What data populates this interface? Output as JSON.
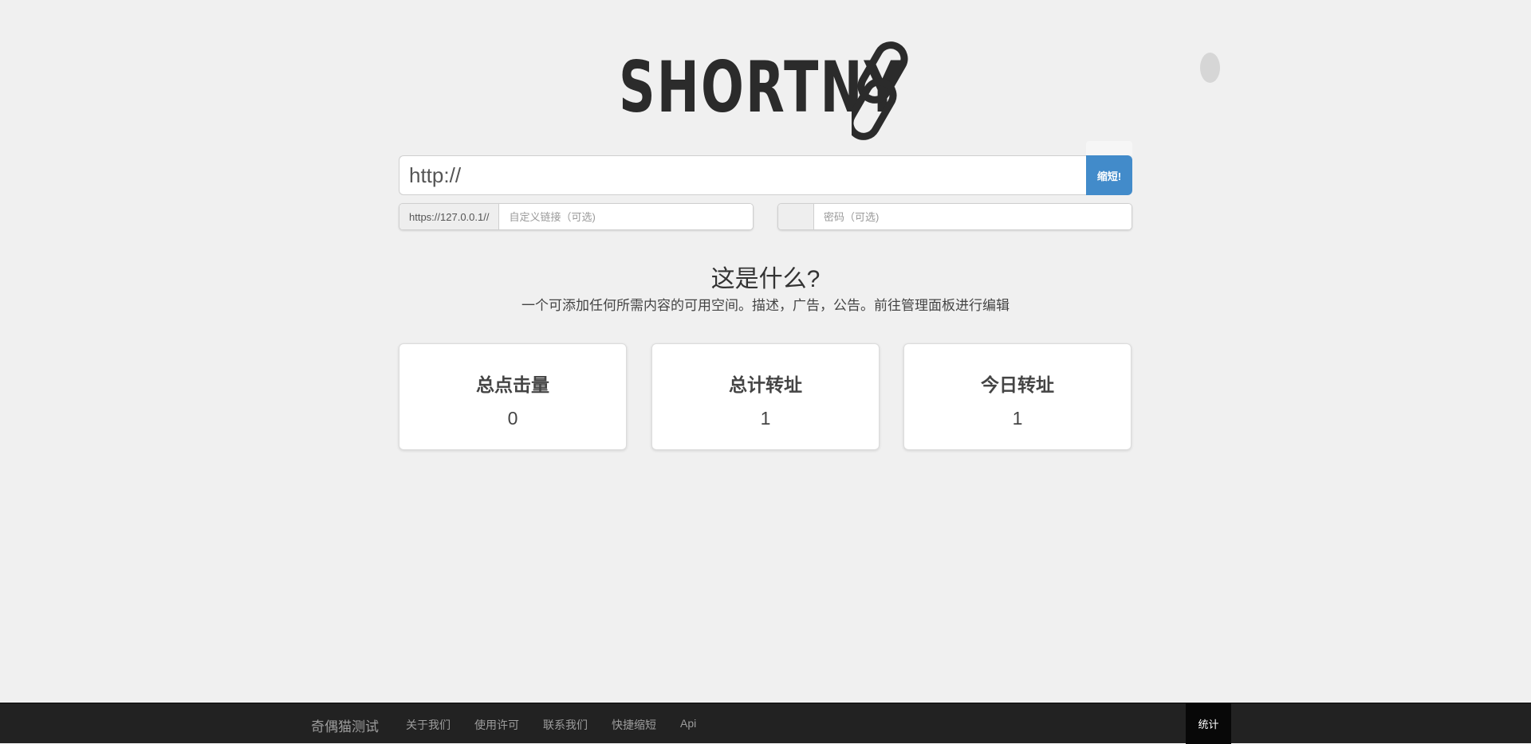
{
  "header": {
    "logo_text": "SHORTNY",
    "logo_icon": "chain-link-icon"
  },
  "shorten_form": {
    "url_value": "http://",
    "submit_label": "缩短!",
    "domain_prefix": "https://127.0.0.1//",
    "custom_alias_placeholder": "自定义链接（可选)",
    "password_placeholder": "密码（可选)"
  },
  "about": {
    "title": "这是什么?",
    "description": "一个可添加任何所需内容的可用空间。描述，广告，公告。前往管理面板进行编辑"
  },
  "stats": [
    {
      "label": "总点击量",
      "value": "0"
    },
    {
      "label": "总计转址",
      "value": "1"
    },
    {
      "label": "今日转址",
      "value": "1"
    }
  ],
  "footer": {
    "brand": "奇偶猫测试",
    "links": [
      "关于我们",
      "使用许可",
      "联系我们",
      "快捷缩短",
      "Api"
    ],
    "stats_label": "统计"
  },
  "colors": {
    "background": "#f0f0f0",
    "accent": "#428bca",
    "footer": "#222222"
  }
}
